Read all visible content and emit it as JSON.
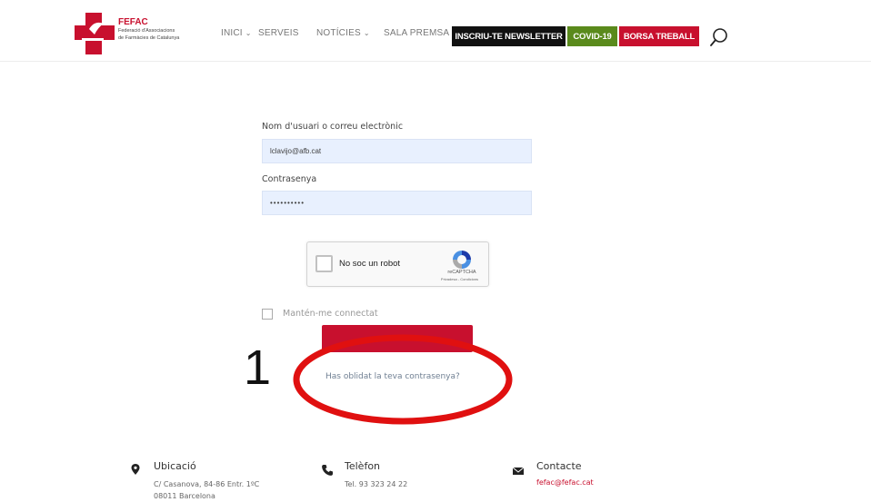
{
  "header": {
    "logo": {
      "name": "FEFAC",
      "subtitle_line1": "Federació d'Associacions",
      "subtitle_line2": "de Farmàcies de Catalunya"
    },
    "nav": [
      {
        "label": "INICI",
        "has_dropdown": true
      },
      {
        "label": "SERVEIS",
        "has_dropdown": false
      },
      {
        "label": "NOTÍCIES",
        "has_dropdown": true
      },
      {
        "label": "SALA PREMSA",
        "has_dropdown": false
      }
    ],
    "buttons": {
      "newsletter": "INSCRIU-TE NEWSLETTER",
      "covid": "COVID-19",
      "borsa": "BORSA TREBALL"
    },
    "search_icon": "search-icon"
  },
  "login": {
    "username_label": "Nom d'usuari o correu electrònic",
    "username_value": "lclavijo@afb.cat",
    "password_label": "Contrasenya",
    "password_value": "••••••••••",
    "recaptcha": {
      "label": "No soc un robot",
      "brand": "reCAPTCHA",
      "links": "Privadesa - Condicions"
    },
    "remember_label": "Mantén-me connectat",
    "forgot_link": "Has oblidat la teva contrasenya?"
  },
  "annotation": {
    "number": "1",
    "color": "#e01010"
  },
  "footer": {
    "location": {
      "title": "Ubicació",
      "line1": "C/ Casanova, 84-86 Entr. 1ºC",
      "line2": "08011 Barcelona"
    },
    "phone": {
      "title": "Telèfon",
      "text": "Tel. 93 323 24 22"
    },
    "contact": {
      "title": "Contacte",
      "email": "fefac@fefac.cat"
    }
  },
  "colors": {
    "brand_red": "#c8102e",
    "covid_green": "#5a8a1c",
    "input_bg": "#e8f0fe"
  }
}
